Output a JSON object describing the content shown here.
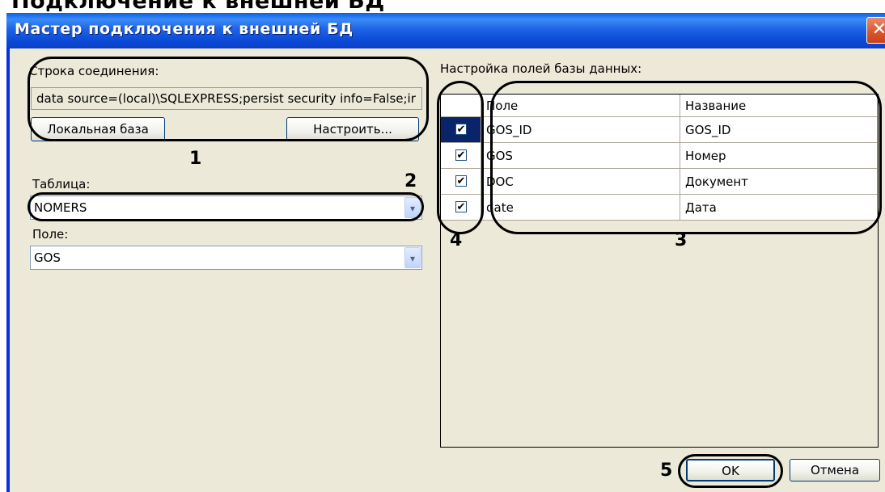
{
  "page_heading": "Подключение к внешней БД",
  "window": {
    "title": "Мастер подключения к внешней БД",
    "close_glyph": "✕"
  },
  "connection": {
    "label": "Строка соединения:",
    "value": "data source=(local)\\SQLEXPRESS;persist security info=False;ir",
    "local_db_button": "Локальная база",
    "configure_button": "Настроить..."
  },
  "table": {
    "label": "Таблица:",
    "value": "NOMERS"
  },
  "field": {
    "label": "Поле:",
    "value": "GOS"
  },
  "db_fields": {
    "label": "Настройка полей базы данных:",
    "columns": [
      "Поле",
      "Название"
    ],
    "rows": [
      {
        "field": "GOS_ID",
        "name": "GOS_ID",
        "checked": true
      },
      {
        "field": "GOS",
        "name": "Номер",
        "checked": true
      },
      {
        "field": "DOC",
        "name": "Документ",
        "checked": true
      },
      {
        "field": "date",
        "name": "Дата",
        "checked": true
      }
    ],
    "check_glyph": "✔"
  },
  "buttons": {
    "ok": "OK",
    "cancel": "Отмена"
  },
  "dropdown_glyph": "▾",
  "callouts": [
    "1",
    "2",
    "3",
    "4",
    "5"
  ]
}
